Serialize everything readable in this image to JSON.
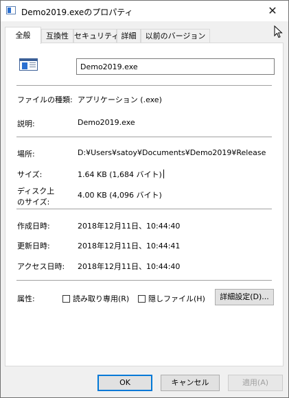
{
  "window": {
    "title": "Demo2019.exeのプロパティ",
    "close_glyph": "✕"
  },
  "tabs": [
    {
      "label": "全般",
      "active": true
    },
    {
      "label": "互換性"
    },
    {
      "label": "セキュリティ"
    },
    {
      "label": "詳細"
    },
    {
      "label": "以前のバージョン"
    }
  ],
  "general": {
    "file_icon": "application-window-icon",
    "file_name": "Demo2019.exe",
    "type_label": "ファイルの種類:",
    "type_value": "アプリケーション (.exe)",
    "description_label": "説明:",
    "description_value": "Demo2019.exe",
    "location_label": "場所:",
    "location_value": "D:¥Users¥satoy¥Documents¥Demo2019¥Release",
    "size_label": "サイズ:",
    "size_value": "1.64 KB (1,684 バイト)",
    "size_on_disk_label_1": "ディスク上",
    "size_on_disk_label_2": "のサイズ:",
    "size_on_disk_value": "4.00 KB (4,096 バイト)",
    "created_label": "作成日時:",
    "created_value": "2018年12月11日、10:44:40",
    "modified_label": "更新日時:",
    "modified_value": "2018年12月11日、10:44:41",
    "accessed_label": "アクセス日時:",
    "accessed_value": "2018年12月11日、10:44:40",
    "attributes_label": "属性:",
    "readonly_label": "読み取り専用(R)",
    "readonly_checked": false,
    "hidden_label": "隠しファイル(H)",
    "hidden_checked": false,
    "advanced_button": "詳細設定(D)..."
  },
  "footer": {
    "ok": "OK",
    "cancel": "キャンセル",
    "apply": "適用(A)"
  },
  "colors": {
    "accent": "#0078d7",
    "window_bg": "#f0f0f0",
    "panel_bg": "#ffffff"
  }
}
